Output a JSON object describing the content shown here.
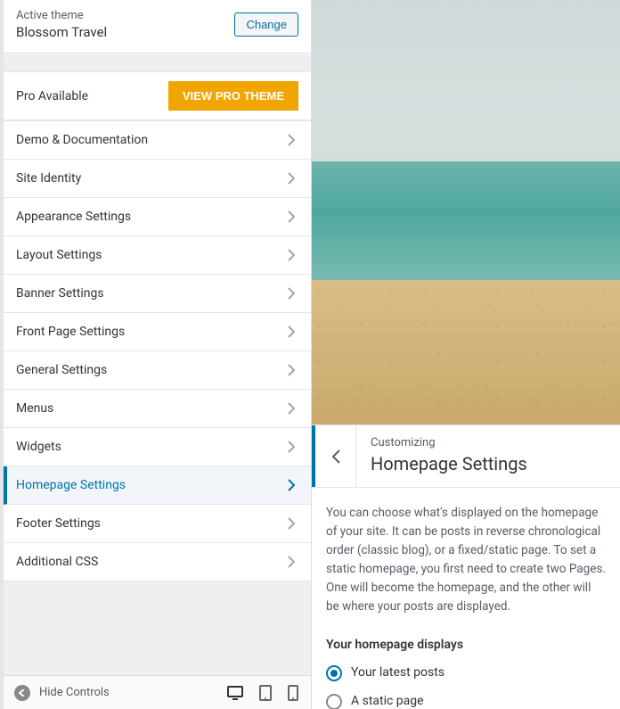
{
  "theme_header": {
    "label": "Active theme",
    "name": "Blossom Travel",
    "change_label": "Change"
  },
  "pro_row": {
    "label": "Pro Available",
    "button": "VIEW PRO THEME"
  },
  "nav": {
    "items": [
      {
        "label": "Demo & Documentation",
        "active": false
      },
      {
        "label": "Site Identity",
        "active": false
      },
      {
        "label": "Appearance Settings",
        "active": false
      },
      {
        "label": "Layout Settings",
        "active": false
      },
      {
        "label": "Banner Settings",
        "active": false
      },
      {
        "label": "Front Page Settings",
        "active": false
      },
      {
        "label": "General Settings",
        "active": false
      },
      {
        "label": "Menus",
        "active": false
      },
      {
        "label": "Widgets",
        "active": false
      },
      {
        "label": "Homepage Settings",
        "active": true
      },
      {
        "label": "Footer Settings",
        "active": false
      },
      {
        "label": "Additional CSS",
        "active": false
      }
    ]
  },
  "bottom": {
    "hide_label": "Hide Controls"
  },
  "subpanel": {
    "crumb": "Customizing",
    "title": "Homepage Settings",
    "desc": "You can choose what's displayed on the homepage of your site. It can be posts in reverse chronological order (classic blog), or a fixed/static page. To set a static homepage, you first need to create two Pages. One will become the homepage, and the other will be where your posts are displayed.",
    "heading": "Your homepage displays",
    "opt1": "Your latest posts",
    "opt2": "A static page"
  },
  "colors": {
    "accent": "#0073aa",
    "pro": "#f0a500"
  }
}
